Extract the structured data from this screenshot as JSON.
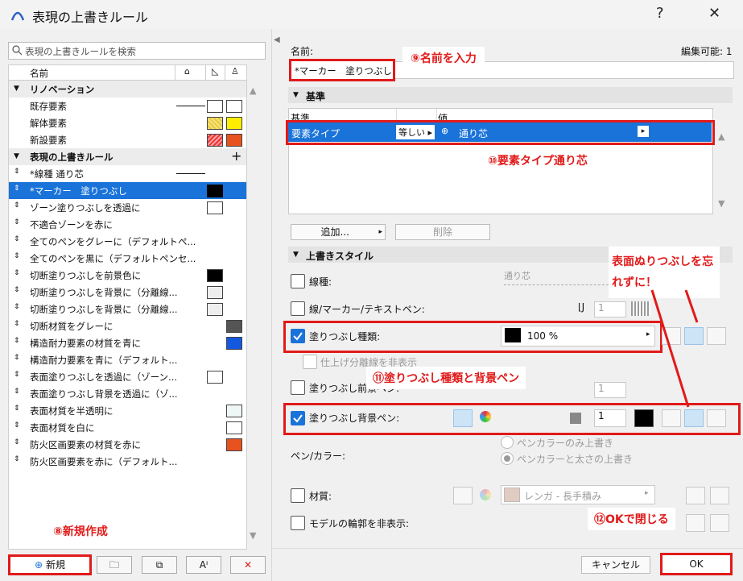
{
  "window": {
    "title": "表現の上書きルール",
    "help": "?",
    "close": "✕"
  },
  "left": {
    "search_placeholder": "表現の上書きルールを検索",
    "col_name": "名前",
    "groups": [
      {
        "label": "リノベーション"
      },
      {
        "label": "表現の上書きルール",
        "add": "+"
      }
    ],
    "items": [
      {
        "label": "既存要素"
      },
      {
        "label": "解体要素"
      },
      {
        "label": "新設要素"
      },
      {
        "label": "*線種 通り芯"
      },
      {
        "label": "*マーカー　塗りつぶし"
      },
      {
        "label": "ゾーン塗りつぶしを透過に"
      },
      {
        "label": "不適合ゾーンを赤に"
      },
      {
        "label": "全てのペンをグレーに（デフォルトペ..."
      },
      {
        "label": "全てのペンを黒に（デフォルトペンセ..."
      },
      {
        "label": "切断塗りつぶしを前景色に"
      },
      {
        "label": "切断塗りつぶしを背景に（分離線..."
      },
      {
        "label": "切断塗りつぶしを背景に（分離線..."
      },
      {
        "label": "切断材質をグレーに"
      },
      {
        "label": "構造耐力要素の材質を青に"
      },
      {
        "label": "構造耐力要素を青に（デフォルト..."
      },
      {
        "label": "表面塗りつぶしを透過に（ゾーン..."
      },
      {
        "label": "表面塗りつぶし背景を透過に（ゾ..."
      },
      {
        "label": "表面材質を半透明に"
      },
      {
        "label": "表面材質を白に"
      },
      {
        "label": "防火区画要素の材質を赤に"
      },
      {
        "label": "防火区画要素を赤に（デフォルト..."
      }
    ],
    "buttons": {
      "new": "新規"
    },
    "annotation_new": "⑧新規作成"
  },
  "right": {
    "name_label": "名前:",
    "editable": "編集可能: 1",
    "name_value": "*マーカー　塗りつぶし",
    "annotation_name": "⑨名前を入力",
    "criteria": {
      "header": "基準",
      "col_criteria": "基準",
      "col_value": "値",
      "row_criteria": "要素タイプ",
      "row_op": "等しい",
      "row_value": "通り芯",
      "annotation": "⑩要素タイプ通り芯",
      "add": "追加...",
      "delete": "削除"
    },
    "style": {
      "header": "上書きスタイル",
      "linetype": "線種:",
      "linetype_value": "通り芯",
      "line_pen": "線/マーカー/テキストペン:",
      "pen_num_1": "1",
      "fill_type": "塗りつぶし種類:",
      "fill_percent": "100 %",
      "hide_sep": "仕上げ分離線を非表示",
      "fill_fg": "塗りつぶし前景ペン:",
      "fill_bg": "塗りつぶし背景ペン:",
      "pen_num_bg": "1",
      "pen_color": "ペン/カラー:",
      "radio1": "ペンカラーのみ上書き",
      "radio2": "ペンカラーと太さの上書き",
      "material": "材質:",
      "material_value": "レンガ - 長手積み",
      "hide_contour": "モデルの輪郭を非表示:",
      "annotation_fill": "⑪塗りつぶし種類と背景ペン",
      "annotation_surface_1": "表面ぬりつぶしを忘",
      "annotation_surface_2": "れずに！"
    },
    "cancel": "キャンセル",
    "ok": "OK",
    "annotation_ok": "⑫OKで閉じる"
  }
}
